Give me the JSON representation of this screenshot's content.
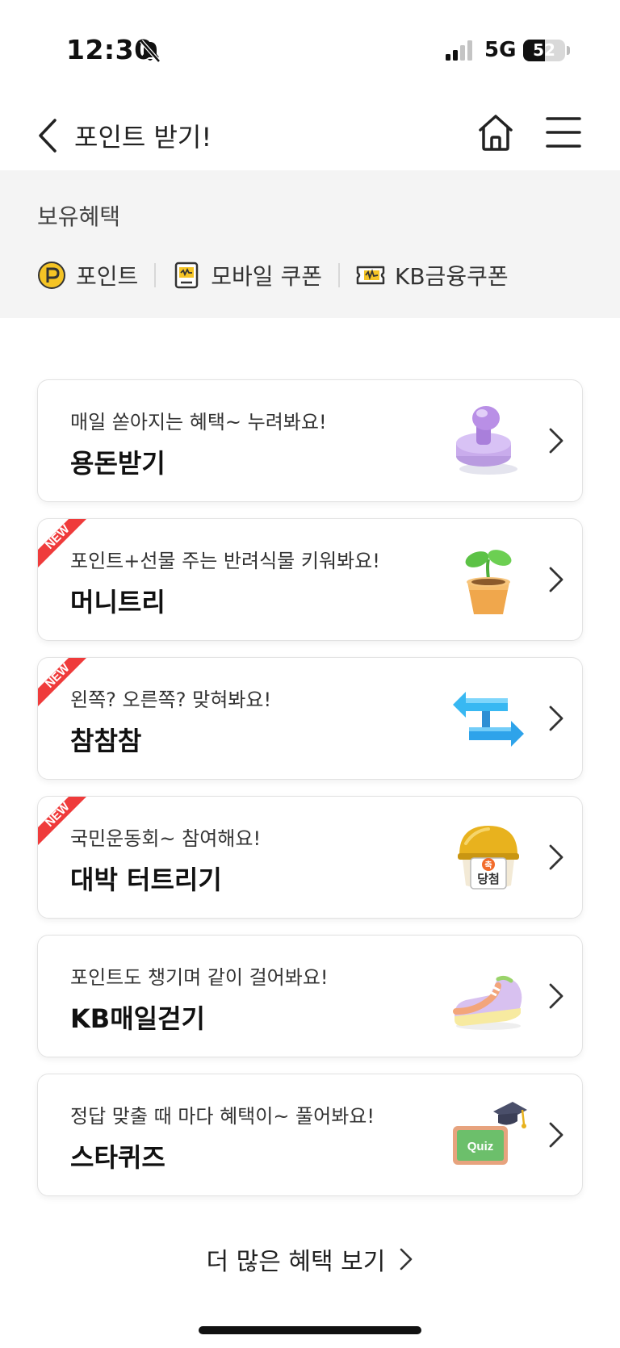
{
  "status_bar": {
    "time": "12:30",
    "network": "5G",
    "battery": "52",
    "battery_level": 0.52
  },
  "header": {
    "title": "포인트 받기!"
  },
  "holdings": {
    "title": "보유혜택",
    "items": [
      {
        "label": "포인트",
        "icon": "point-coin-icon"
      },
      {
        "label": "모바일 쿠폰",
        "icon": "mobile-coupon-icon"
      },
      {
        "label": "KB금융쿠폰",
        "icon": "kb-coupon-icon"
      }
    ]
  },
  "cards": [
    {
      "subtitle": "매일 쏟아지는 혜택~ 누려봐요!",
      "title": "용돈받기",
      "is_new": false,
      "image": "stamp-icon"
    },
    {
      "subtitle": "포인트+선물 주는 반려식물 키워봐요!",
      "title": "머니트리",
      "is_new": true,
      "image": "plant-pot-icon"
    },
    {
      "subtitle": "왼쪽? 오른쪽? 맞혀봐요!",
      "title": "참참참",
      "is_new": true,
      "image": "direction-sign-icon"
    },
    {
      "subtitle": "국민운동회~ 참여해요!",
      "title": "대박 터트리기",
      "is_new": true,
      "image": "lucky-ball-icon"
    },
    {
      "subtitle": "포인트도 챙기며 같이 걸어봐요!",
      "title": "KB매일걷기",
      "is_new": false,
      "image": "sneaker-icon"
    },
    {
      "subtitle": "정답 맞출 때 마다 혜택이~ 풀어봐요!",
      "title": "스타퀴즈",
      "is_new": false,
      "image": "quiz-board-icon"
    }
  ],
  "ribbon_label": "NEW",
  "lucky_ball": {
    "badge": "축",
    "text": "당첨"
  },
  "quiz_board": {
    "text": "Quiz"
  },
  "more_link": {
    "label": "더 많은 혜택 보기"
  },
  "colors": {
    "ribbon": "#ef3b3b",
    "point_coin": "#f5c425",
    "section_bg": "#f4f4f4"
  }
}
